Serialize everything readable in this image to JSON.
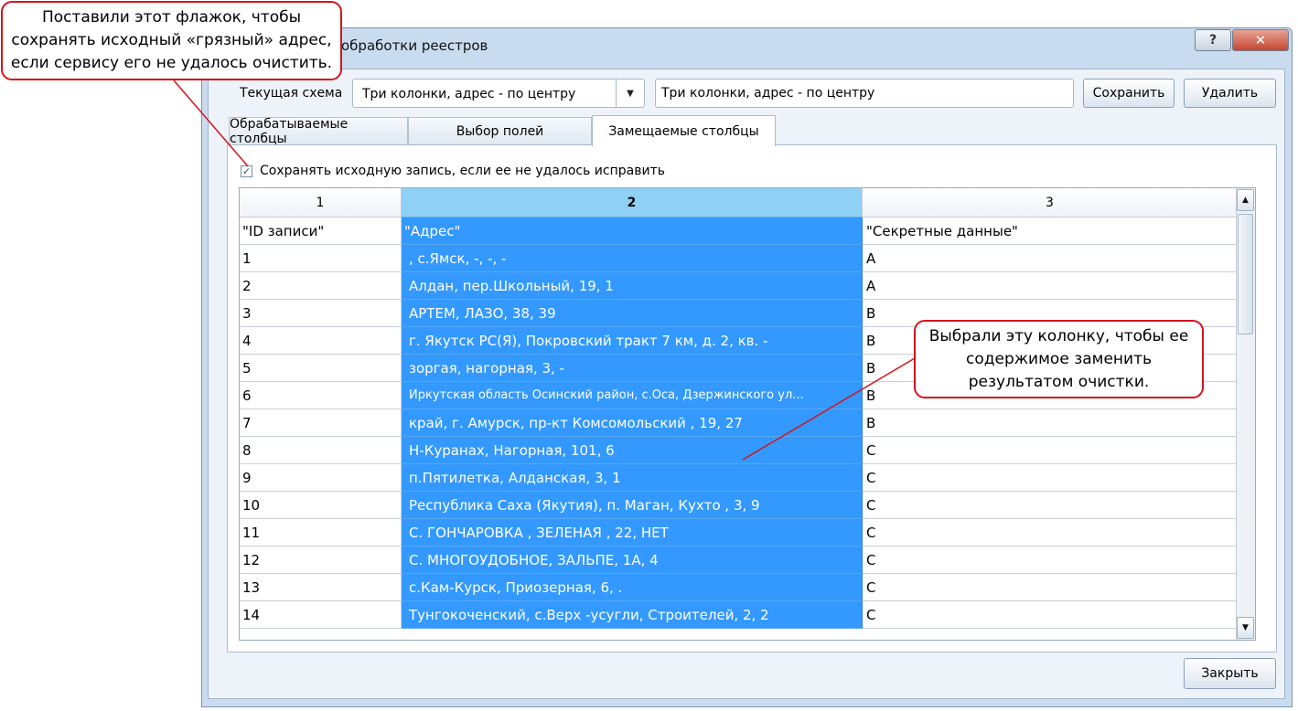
{
  "window": {
    "title": "обработки реестров",
    "help_label": "?",
    "close_label": "✕"
  },
  "scheme": {
    "label": "Текущая схема",
    "selected": "Три колонки, адрес - по центру",
    "name_value": "Три колонки, адрес - по центру",
    "save_label": "Сохранить",
    "delete_label": "Удалить"
  },
  "tabs": [
    {
      "label": "Обрабатываемые столбцы"
    },
    {
      "label": "Выбор полей"
    },
    {
      "label": "Замещаемые столбцы"
    }
  ],
  "checkbox": {
    "checked": true,
    "mark": "✓",
    "label": "Сохранять исходную запись, если ее не удалось исправить"
  },
  "grid": {
    "columns": [
      "1",
      "2",
      "3"
    ],
    "selected_column": "2",
    "rows": [
      [
        "\"ID записи\"",
        "\"Адрес\"",
        "\"Секретные данные\""
      ],
      [
        "1",
        ", с.Ямск, -, -, -",
        "А"
      ],
      [
        "2",
        "Алдан, пер.Школьный, 19, 1",
        "А"
      ],
      [
        "3",
        "АРТЕМ, ЛАЗО, 38, 39",
        "В"
      ],
      [
        "4",
        "г. Якутск РС(Я), Покровский тракт 7 км, д. 2, кв. -",
        "В"
      ],
      [
        "5",
        "зоргая, нагорная, 3,  -",
        "В"
      ],
      [
        "6",
        "Иркутская область Осинский район, с.Оса, Дзержинского ул...",
        "В"
      ],
      [
        "7",
        "край, г. Амурск, пр-кт Комсомольский , 19, 27",
        "В"
      ],
      [
        "8",
        "Н-Куранах, Нагорная, 101, 6",
        "С"
      ],
      [
        "9",
        "п.Пятилетка, Алданская, 3, 1",
        "С"
      ],
      [
        "10",
        "Республика Саха (Якутия), п. Маган, Кухто , 3, 9",
        "С"
      ],
      [
        "11",
        "С. ГОНЧАРОВКА , ЗЕЛЕНАЯ , 22, НЕТ",
        "С"
      ],
      [
        "12",
        "С. МНОГОУДОБНОЕ, ЗАЛЬПЕ, 1А, 4",
        "С"
      ],
      [
        "13",
        "с.Кам-Курск, Приозерная, 6, .",
        "С"
      ],
      [
        "14",
        "Тунгокоченский, с.Верх -усугли, Строителей, 2, 2",
        "С"
      ]
    ]
  },
  "close_label": "Закрыть",
  "callouts": {
    "checkbox_note": [
      "Поставили этот флажок, чтобы",
      "сохранять исходный «грязный» адрес,",
      "если сервису его не удалось очистить."
    ],
    "column_note": [
      "Выбрали эту колонку, чтобы ее",
      "содержимое заменить",
      "результатом очистки."
    ]
  },
  "colors": {
    "selection": "#3399ff",
    "selected_header": "#8fd0f5",
    "callout_border": "#d4141b"
  }
}
